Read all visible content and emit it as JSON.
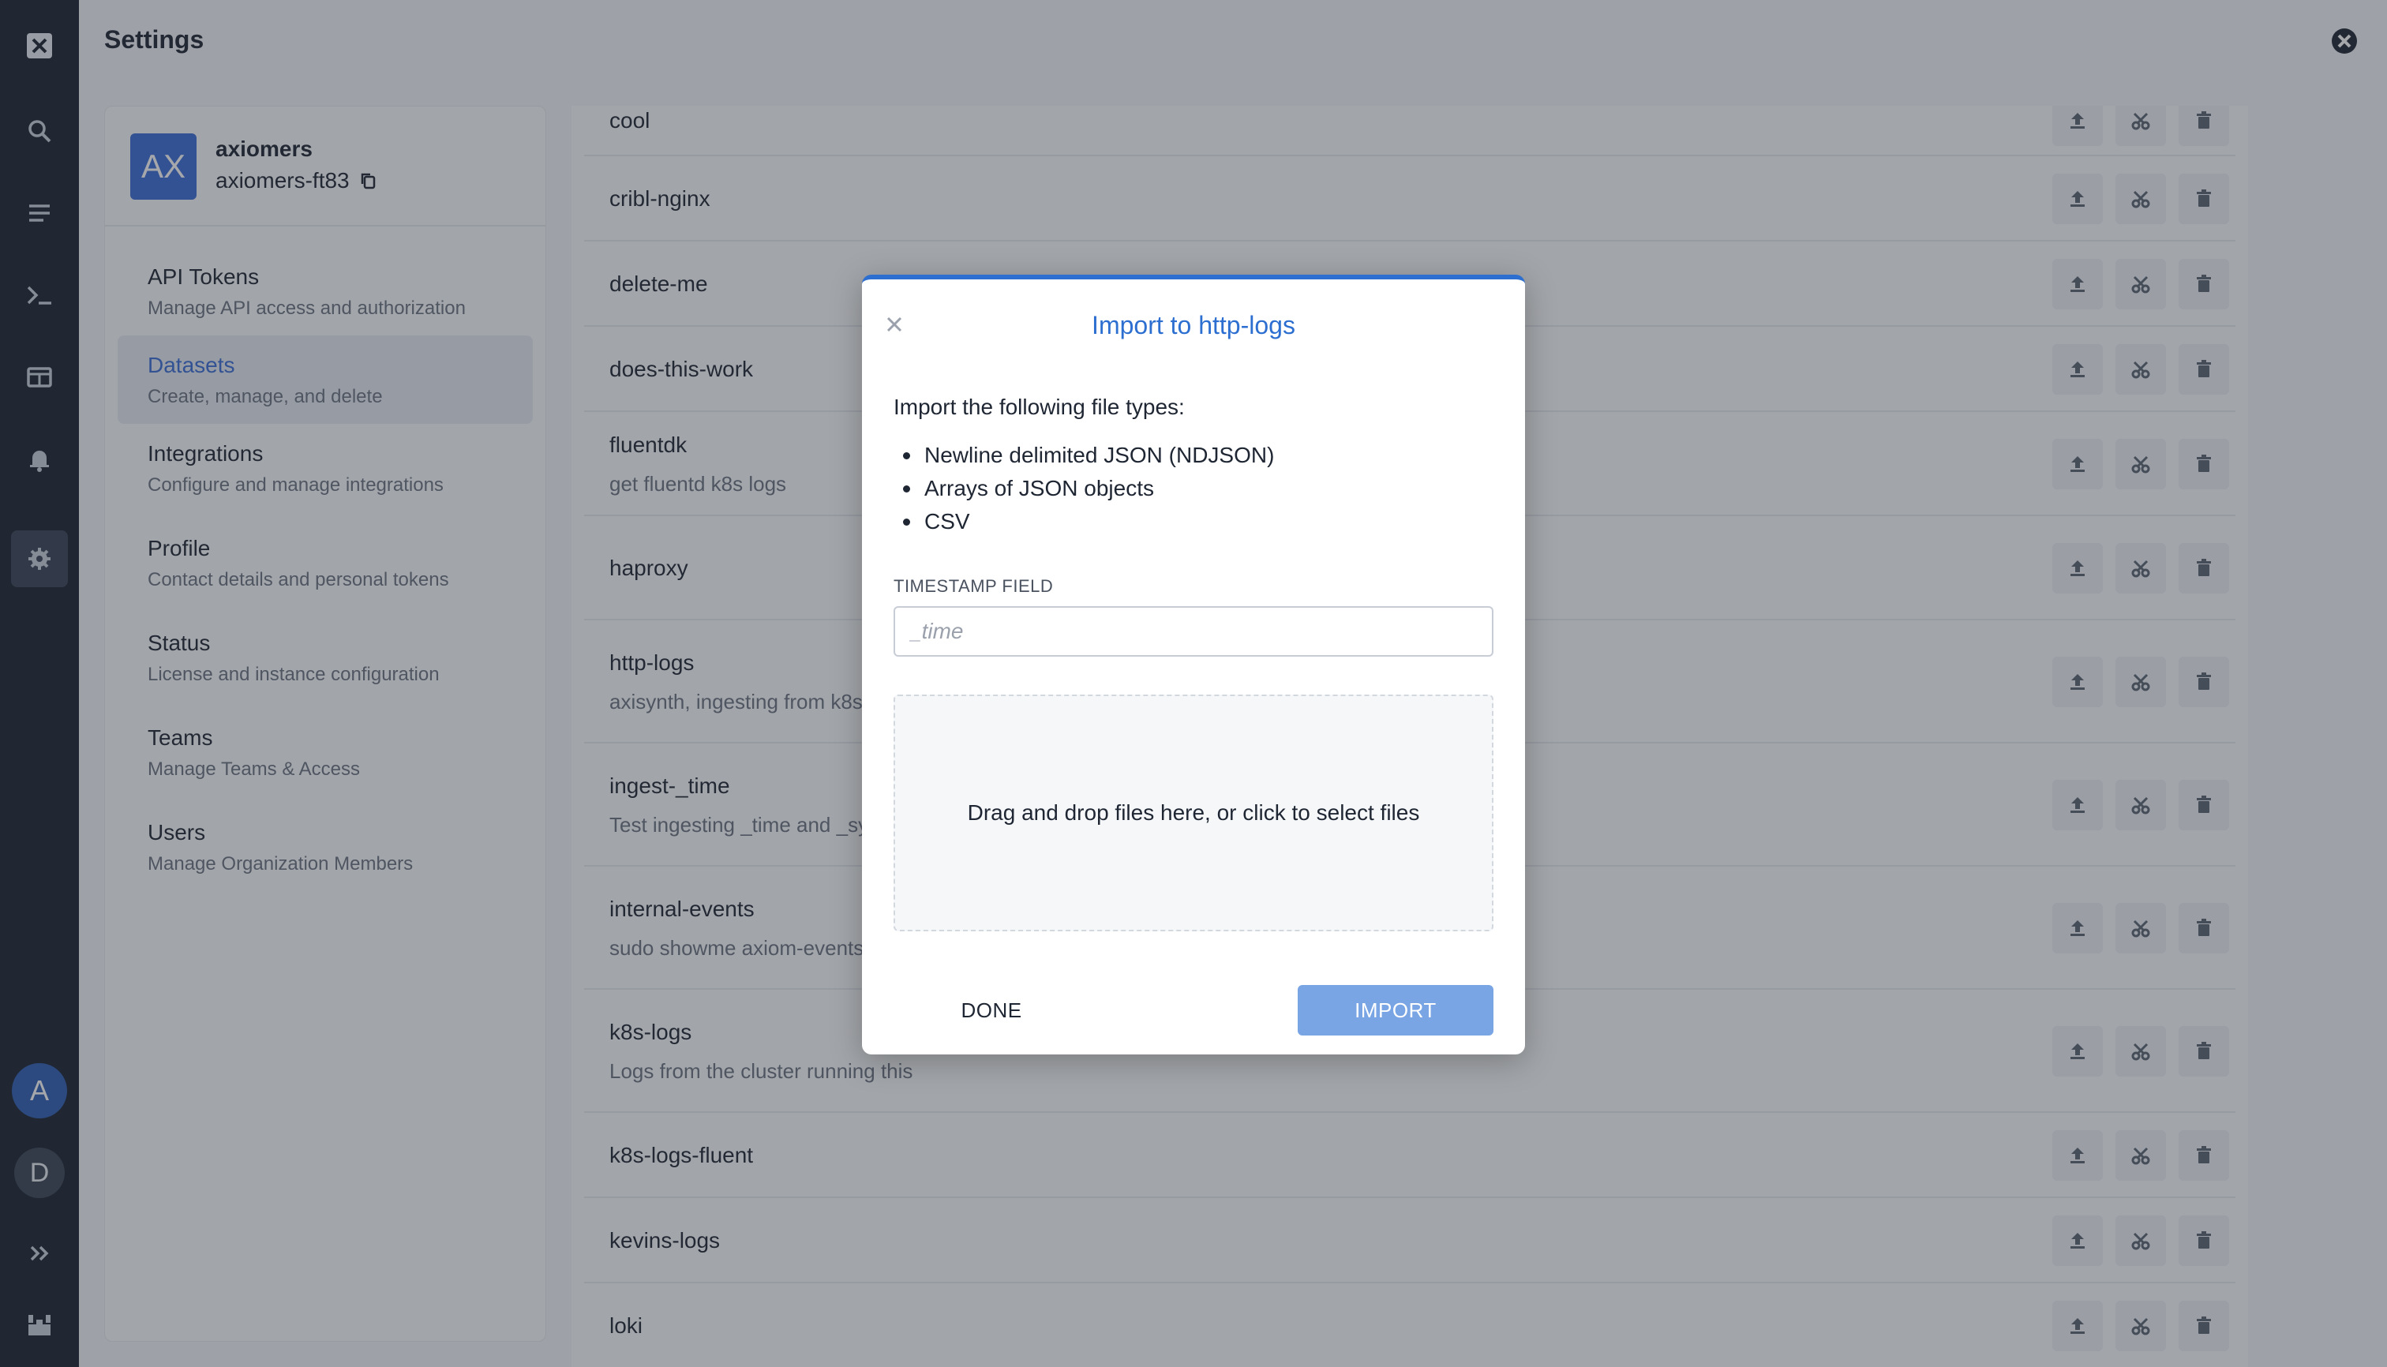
{
  "app": {
    "title": "Settings"
  },
  "rail": {
    "avatar_primary": "A",
    "avatar_secondary": "D"
  },
  "org": {
    "initials": "AX",
    "name": "axiomers",
    "slug": "axiomers-ft83"
  },
  "settings_nav": [
    {
      "label": "API Tokens",
      "desc": "Manage API access and authorization"
    },
    {
      "label": "Datasets",
      "desc": "Create, manage, and delete",
      "active": true
    },
    {
      "label": "Integrations",
      "desc": "Configure and manage integrations"
    },
    {
      "label": "Profile",
      "desc": "Contact details and personal tokens"
    },
    {
      "label": "Status",
      "desc": "License and instance configuration"
    },
    {
      "label": "Teams",
      "desc": "Manage Teams & Access"
    },
    {
      "label": "Users",
      "desc": "Manage Organization Members"
    }
  ],
  "datasets": [
    {
      "name": "cool",
      "desc": ""
    },
    {
      "name": "cribl-nginx",
      "desc": ""
    },
    {
      "name": "delete-me",
      "desc": ""
    },
    {
      "name": "does-this-work",
      "desc": ""
    },
    {
      "name": "fluentdk",
      "desc": "get fluentd k8s logs"
    },
    {
      "name": "haproxy",
      "desc": ""
    },
    {
      "name": "http-logs",
      "desc": "axisynth, ingesting from k8s"
    },
    {
      "name": "ingest-_time",
      "desc": "Test ingesting _time and _sy"
    },
    {
      "name": "internal-events",
      "desc": "sudo showme axiom-events"
    },
    {
      "name": "k8s-logs",
      "desc": "Logs from the cluster running this"
    },
    {
      "name": "k8s-logs-fluent",
      "desc": ""
    },
    {
      "name": "kevins-logs",
      "desc": ""
    },
    {
      "name": "loki",
      "desc": ""
    }
  ],
  "modal": {
    "title": "Import to http-logs",
    "intro": "Import the following file types:",
    "file_types": [
      "Newline delimited JSON (NDJSON)",
      "Arrays of JSON objects",
      "CSV"
    ],
    "timestamp_label": "TIMESTAMP FIELD",
    "timestamp_placeholder": "_time",
    "timestamp_value": "",
    "dropzone_text": "Drag and drop files here, or click to select files",
    "done_label": "DONE",
    "import_label": "IMPORT"
  },
  "colors": {
    "accent": "#2d6fd0",
    "rail_bg": "#1b2330",
    "import_button": "#79a5e4"
  }
}
